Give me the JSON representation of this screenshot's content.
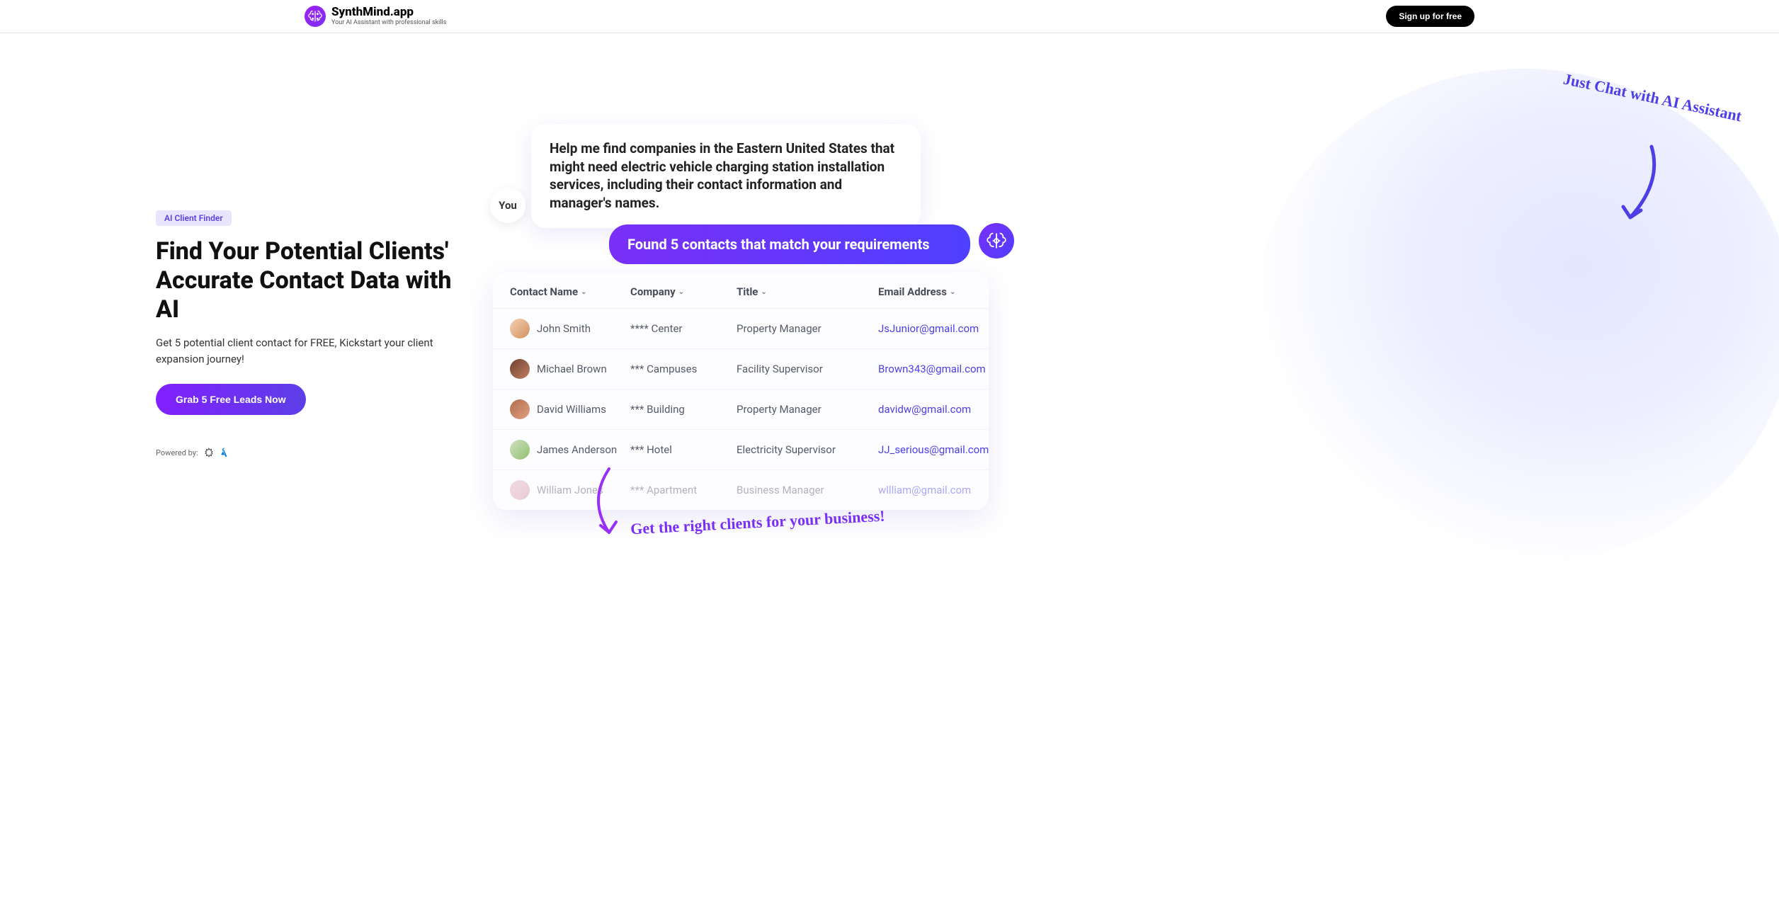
{
  "header": {
    "logo_title": "SynthMind.app",
    "logo_subtitle": "Your AI Assistant with professional skills",
    "signup_label": "Sign up for free"
  },
  "hero": {
    "badge": "AI Client Finder",
    "headline": "Find Your Potential Clients' Accurate Contact Data with AI",
    "subtext": "Get 5 potential client contact for FREE, Kickstart your client expansion journey!",
    "cta_label": "Grab 5 Free Leads Now",
    "powered_label": "Powered by:"
  },
  "annotations": {
    "top": "Just Chat with AI Assistant",
    "bottom": "Get the right clients for your business!"
  },
  "chat": {
    "user_label": "You",
    "user_message": "Help me find companies in the Eastern United States that might need electric vehicle charging station installation services, including their contact information and manager's names.",
    "ai_message": "Found 5 contacts that match your requirements"
  },
  "table": {
    "headers": {
      "name": "Contact Name",
      "company": "Company",
      "title": "Title",
      "email": "Email Address"
    },
    "rows": [
      {
        "name": "John Smith",
        "company": "**** Center",
        "title": "Property Manager",
        "email": "JsJunior@gmail.com"
      },
      {
        "name": "Michael Brown",
        "company": "*** Campuses",
        "title": "Facility Supervisor",
        "email": "Brown343@gmail.com"
      },
      {
        "name": "David Williams",
        "company": "*** Building",
        "title": "Property Manager",
        "email": "davidw@gmail.com"
      },
      {
        "name": "James Anderson",
        "company": "*** Hotel",
        "title": "Electricity Supervisor",
        "email": "JJ_serious@gmail.com"
      },
      {
        "name": "William Jones",
        "company": "*** Apartment",
        "title": "Business Manager",
        "email": "wllliam@gmail.com"
      }
    ]
  }
}
